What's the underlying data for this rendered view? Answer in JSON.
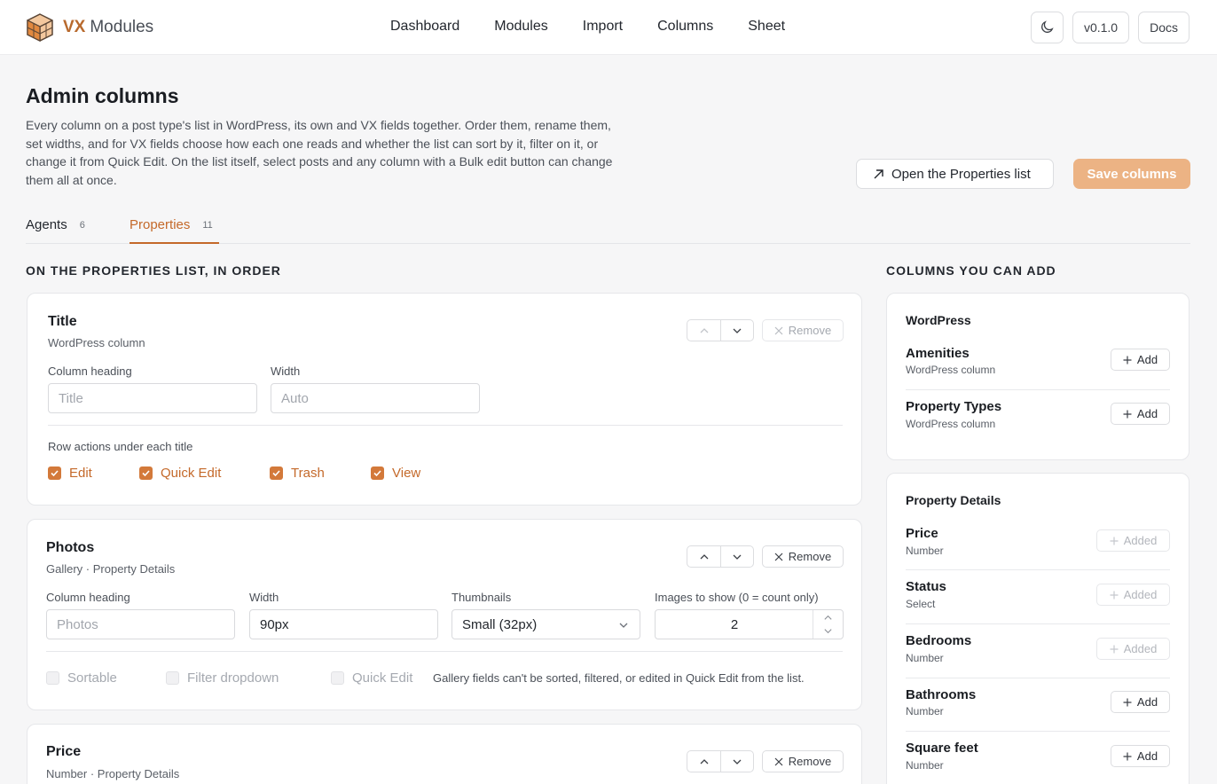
{
  "brand": {
    "prefix": "VX",
    "name": "Modules"
  },
  "nav": [
    "Dashboard",
    "Modules",
    "Import",
    "Columns",
    "Sheet"
  ],
  "top_right": {
    "theme_icon": "moon-icon",
    "version": "v0.1.0",
    "docs": "Docs"
  },
  "header": {
    "title": "Admin columns",
    "description": "Every column on a post type's list in WordPress, its own and VX fields together. Order them, rename them, set widths, and for VX fields choose how each one reads and whether the list can sort by it, filter on it, or change it from Quick Edit. On the list itself, select posts and any column with a Bulk edit button can change them all at once.",
    "open_list": "Open the Properties list",
    "save": "Save columns"
  },
  "tabs": [
    {
      "label": "Agents",
      "count": "6",
      "active": false
    },
    {
      "label": "Properties",
      "count": "11",
      "active": true
    }
  ],
  "left": {
    "heading": "ON THE PROPERTIES LIST, IN ORDER",
    "cards": [
      {
        "title": "Title",
        "subtitle": "WordPress column",
        "remove": "Remove",
        "fields": [
          {
            "label": "Column heading",
            "placeholder": "Title"
          },
          {
            "label": "Width",
            "placeholder": "Auto"
          }
        ],
        "row_actions_label": "Row actions under each title",
        "row_actions": [
          "Edit",
          "Quick Edit",
          "Trash",
          "View"
        ]
      },
      {
        "title": "Photos",
        "subtitle": "Gallery · Property Details",
        "remove": "Remove",
        "fields": [
          {
            "label": "Column heading",
            "placeholder": "Photos"
          },
          {
            "label": "Width",
            "value": "90px"
          },
          {
            "label": "Thumbnails",
            "value": "Small (32px)"
          },
          {
            "label": "Images to show (0 = count only)",
            "value": "2"
          }
        ],
        "options": [
          "Sortable",
          "Filter dropdown",
          "Quick Edit"
        ],
        "note": "Gallery fields can't be sorted, filtered, or edited in Quick Edit from the list."
      },
      {
        "title": "Price",
        "subtitle": "Number · Property Details",
        "remove": "Remove"
      }
    ]
  },
  "right": {
    "heading": "COLUMNS YOU CAN ADD",
    "groups": [
      {
        "title": "WordPress",
        "items": [
          {
            "name": "Amenities",
            "type": "WordPress column",
            "action": "Add"
          },
          {
            "name": "Property Types",
            "type": "WordPress column",
            "action": "Add"
          }
        ]
      },
      {
        "title": "Property Details",
        "items": [
          {
            "name": "Price",
            "type": "Number",
            "action": "Added"
          },
          {
            "name": "Status",
            "type": "Select",
            "action": "Added"
          },
          {
            "name": "Bedrooms",
            "type": "Number",
            "action": "Added"
          },
          {
            "name": "Bathrooms",
            "type": "Number",
            "action": "Add"
          },
          {
            "name": "Square feet",
            "type": "Number",
            "action": "Add"
          }
        ]
      }
    ]
  },
  "colors": {
    "accent": "#c4692a",
    "save_button": "#ecb384"
  }
}
